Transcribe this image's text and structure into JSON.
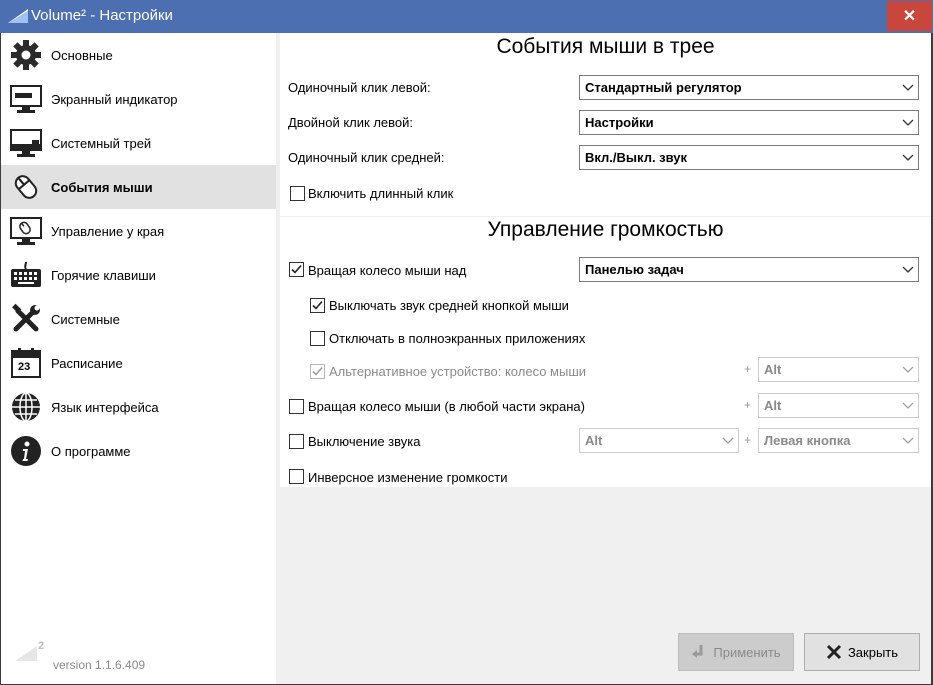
{
  "window": {
    "title": "Volume² - Настройки",
    "close_glyph": "✕"
  },
  "sidebar": {
    "items": [
      {
        "label": "Основные",
        "icon": "gear-icon"
      },
      {
        "label": "Экранный индикатор",
        "icon": "monitor-indicator-icon"
      },
      {
        "label": "Системный трей",
        "icon": "monitor-tray-icon"
      },
      {
        "label": "События мыши",
        "icon": "mouse-icon",
        "active": true
      },
      {
        "label": "Управление у края",
        "icon": "screen-edge-icon"
      },
      {
        "label": "Горячие клавиши",
        "icon": "keyboard-icon"
      },
      {
        "label": "Системные",
        "icon": "tools-icon"
      },
      {
        "label": "Расписание",
        "icon": "calendar-icon",
        "day": "23"
      },
      {
        "label": "Язык интерфейса",
        "icon": "globe-icon"
      },
      {
        "label": "О программе",
        "icon": "info-icon"
      }
    ],
    "version": "version 1.1.6.409",
    "logo_superscript": "2"
  },
  "tray_events": {
    "heading": "События мыши в трее",
    "single_left": {
      "label": "Одиночный клик левой:",
      "value": "Стандартный регулятор"
    },
    "double_left": {
      "label": "Двойной клик левой:",
      "value": "Настройки"
    },
    "single_middle": {
      "label": "Одиночный клик средней:",
      "value": "Вкл./Выкл. звук"
    },
    "long_click": {
      "label": "Включить длинный клик",
      "checked": false
    }
  },
  "volume_control": {
    "heading": "Управление громкостью",
    "wheel_over": {
      "label": "Вращая колесо мыши над",
      "checked": true,
      "value": "Панелью задач"
    },
    "mute_middle": {
      "label": "Выключать звук средней кнопкой мыши",
      "checked": true
    },
    "disable_fullscreen": {
      "label": "Отключать в полноэкранных приложениях",
      "checked": false
    },
    "alt_device": {
      "label": "Альтернативное устройство: колесо мыши",
      "checked": true,
      "disabled": true,
      "modifier": "Alt"
    },
    "wheel_anywhere": {
      "label": "Вращая колесо мыши (в любой части экрана)",
      "checked": false,
      "modifier": "Alt"
    },
    "mute": {
      "label": "Выключение звука",
      "checked": false,
      "modifier": "Alt",
      "button": "Левая кнопка"
    },
    "inverse": {
      "label": "Инверсное изменение громкости",
      "checked": false
    },
    "plus_sign": "+"
  },
  "buttons": {
    "apply": "Применить",
    "close": "Закрыть"
  }
}
